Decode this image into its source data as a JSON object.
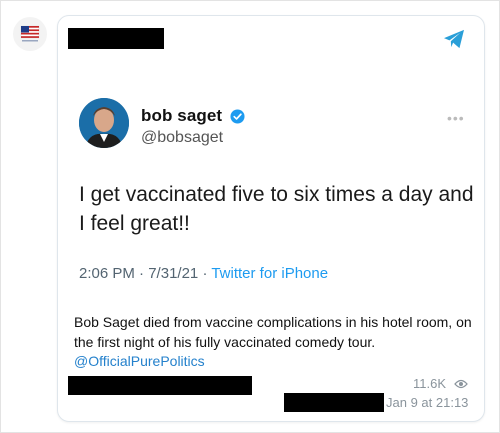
{
  "post": {
    "embedded_tweet": {
      "name": "bob saget",
      "handle": "@bobsaget",
      "text": "I get vaccinated five to six times a day and I feel great!!",
      "time": "2:06 PM",
      "date": "7/31/21",
      "separator": "·",
      "source": "Twitter for iPhone",
      "verified_icon": "verified-badge-icon",
      "more_icon": "more-dots-icon"
    },
    "caption": "Bob Saget died from vaccine complications in his hotel room, on the first night of his fully vaccinated comedy tour.",
    "mention": "@OfficialPurePolitics",
    "views": "11.6K",
    "timestamp": "Jan 9 at 21:13"
  },
  "colors": {
    "accent": "#2481cc",
    "twitter_blue": "#1d9bf0",
    "muted": "#8a949c",
    "redaction": "#000000"
  }
}
